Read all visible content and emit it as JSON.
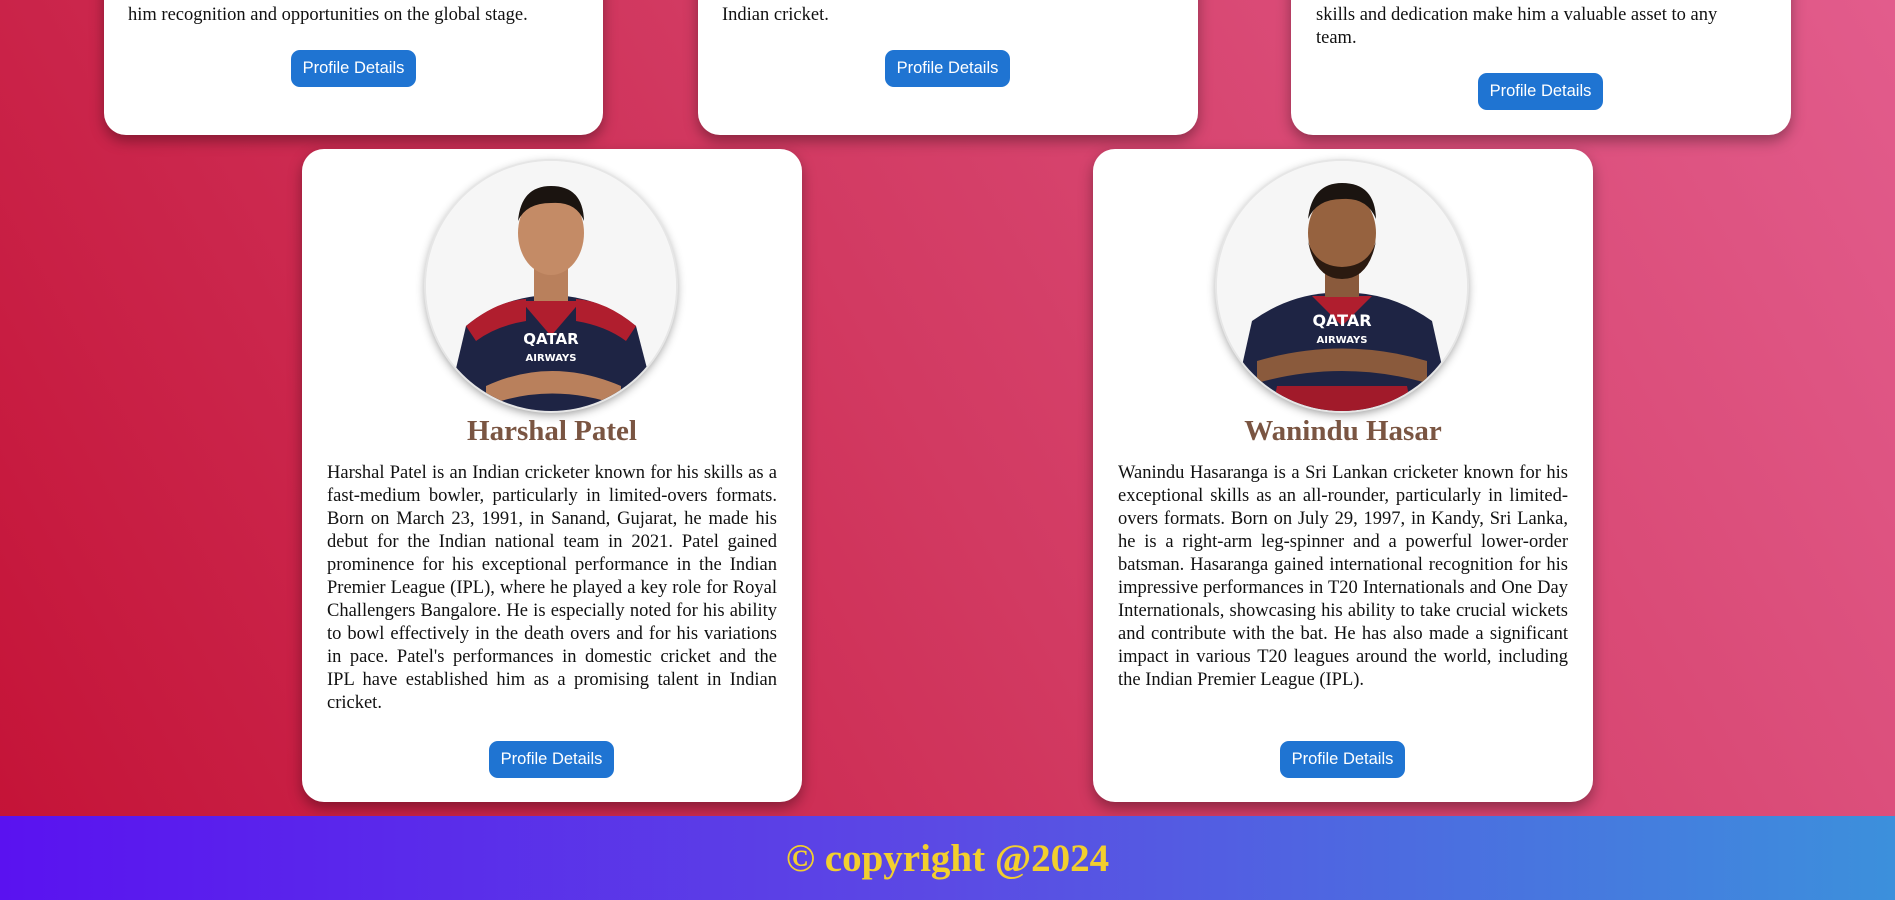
{
  "top_cards": [
    {
      "text_lines": [
        "him recognition and opportunities on the global stage."
      ],
      "button_label": "Profile Details"
    },
    {
      "text_lines": [
        "Indian cricket."
      ],
      "button_label": "Profile Details"
    },
    {
      "text_lines": [
        "skills and dedication make him a valuable asset to any",
        "team."
      ],
      "button_label": "Profile Details"
    }
  ],
  "players": [
    {
      "name": "Harshal Patel",
      "bio": "Harshal Patel is an Indian cricketer known for his skills as a fast-medium bowler, particularly in limited-overs formats. Born on March 23, 1991, in Sanand, Gujarat, he made his debut for the Indian national team in 2021. Patel gained prominence for his exceptional performance in the Indian Premier League (IPL), where he played a key role for Royal Challengers Bangalore. He is especially noted for his ability to bowl effectively in the death overs and for his variations in pace. Patel's performances in domestic cricket and the IPL have established him as a promising talent in Indian cricket.",
      "button_label": "Profile Details",
      "jersey_text": "QATAR AIRWAYS"
    },
    {
      "name": "Wanindu Hasar",
      "bio": "Wanindu Hasaranga is a Sri Lankan cricketer known for his exceptional skills as an all-rounder, particularly in limited-overs formats. Born on July 29, 1997, in Kandy, Sri Lanka, he is a right-arm leg-spinner and a powerful lower-order batsman. Hasaranga gained international recognition for his impressive performances in T20 Internationals and One Day Internationals, showcasing his ability to take crucial wickets and contribute with the bat. He has also made a significant impact in various T20 leagues around the world, including the Indian Premier League (IPL).",
      "button_label": "Profile Details",
      "jersey_text": "QATAR AIRWAYS"
    }
  ],
  "footer": {
    "text": "© copyright @2024"
  },
  "colors": {
    "button": "#1f74d2",
    "name": "#7a5542",
    "footer_text": "#f2cf2e"
  }
}
